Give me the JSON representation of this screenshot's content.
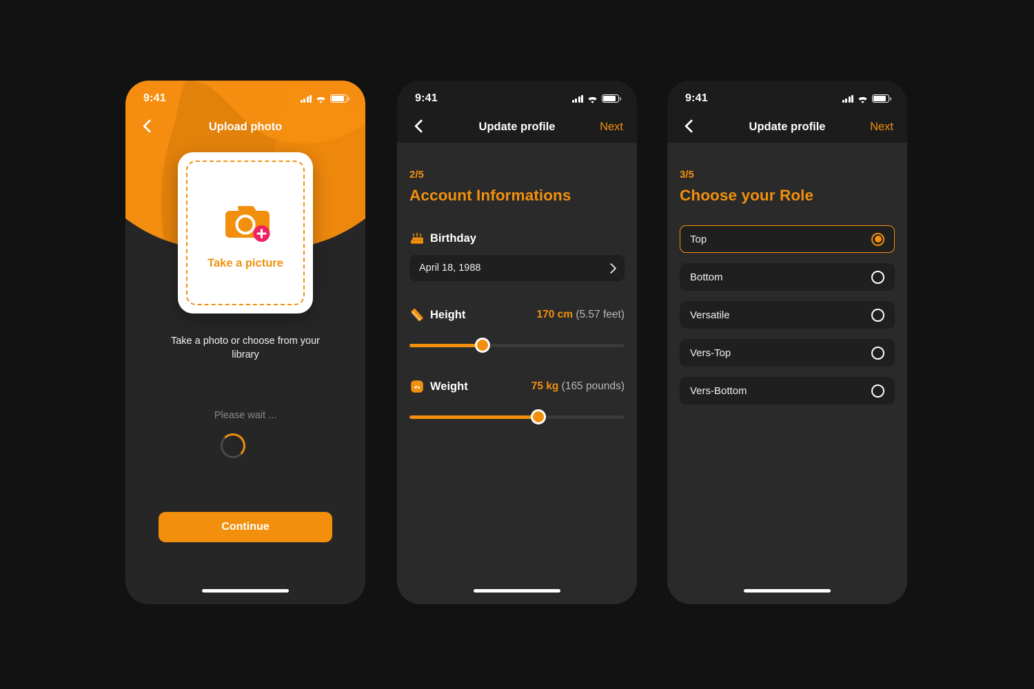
{
  "theme": {
    "accent": "#F2900D",
    "badge_pink": "#F0215F",
    "page_bg": "#121212",
    "screen_bg": "#2a2a2a",
    "navbar_bg": "#1c1c1c",
    "field_bg": "#1f1f1f",
    "track_bg": "#3a3a3a",
    "card_white": "#ffffff",
    "spinner_dim": "#4a4a4a"
  },
  "status_bar": {
    "time": "9:41",
    "signal_icon": "cellular-signal-icon",
    "wifi_icon": "wifi-icon",
    "battery_icon": "battery-icon"
  },
  "screen1": {
    "nav": {
      "back_icon": "chevron-left-icon",
      "title": "Upload photo"
    },
    "upload_card": {
      "camera_icon": "camera-icon",
      "add_badge_icon": "plus-badge-icon",
      "label": "Take a picture"
    },
    "caption": "Take a photo or choose from your library",
    "loading": {
      "text": "Please wait ...",
      "spinner_icon": "loading-spinner-icon"
    },
    "continue_label": "Continue"
  },
  "screen2": {
    "nav": {
      "back_icon": "chevron-left-icon",
      "title": "Update profile",
      "next_label": "Next"
    },
    "step": "2/5",
    "title": "Account Informations",
    "birthday": {
      "icon": "birthday-cake-icon",
      "label": "Birthday",
      "value": "April 18, 1988",
      "chevron_icon": "chevron-right-icon"
    },
    "height": {
      "icon": "ruler-icon",
      "label": "Height",
      "value": "170 cm",
      "secondary": "(5.57 feet)",
      "percent": 34
    },
    "weight": {
      "icon": "weight-scale-icon",
      "label": "Weight",
      "value": "75 kg",
      "secondary": "(165 pounds)",
      "percent": 60
    }
  },
  "screen3": {
    "nav": {
      "back_icon": "chevron-left-icon",
      "title": "Update profile",
      "next_label": "Next"
    },
    "step": "3/5",
    "title": "Choose your Role",
    "roles": [
      {
        "label": "Top",
        "selected": true
      },
      {
        "label": "Bottom",
        "selected": false
      },
      {
        "label": "Versatile",
        "selected": false
      },
      {
        "label": "Vers-Top",
        "selected": false
      },
      {
        "label": "Vers-Bottom",
        "selected": false
      }
    ]
  }
}
